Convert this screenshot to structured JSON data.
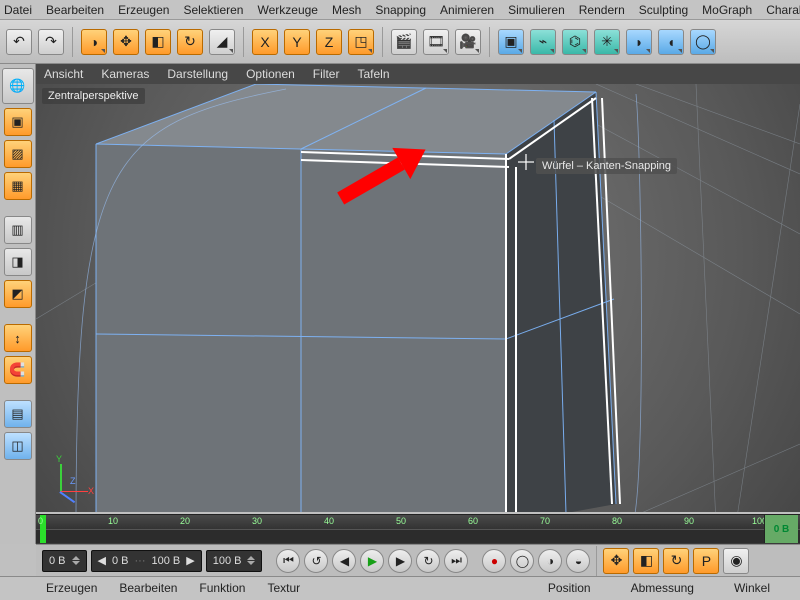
{
  "menu": {
    "items": [
      "Datei",
      "Bearbeiten",
      "Erzeugen",
      "Selektieren",
      "Werkzeuge",
      "Mesh",
      "Snapping",
      "Animieren",
      "Simulieren",
      "Rendern",
      "Sculpting",
      "MoGraph",
      "Charak"
    ]
  },
  "toolbar": {
    "undo": "↶",
    "redo": "↷",
    "live": "◑",
    "move": "✥",
    "scale": "◧",
    "rot": "↻",
    "lasttool": "◢",
    "x": "X",
    "y": "Y",
    "z": "Z",
    "coord": "◳",
    "render": "🎬",
    "renderreg": "🎞",
    "rendset": "🎥",
    "prim": "▣",
    "def": "⌁",
    "gen": "⌬",
    "env": "✳",
    "cam": "◗",
    "light": "◖",
    "spline": "◯"
  },
  "lefttools": {
    "cube": "▣",
    "poly": "▨",
    "mat": "▦",
    "model": "▥",
    "obj": "◨",
    "tex": "◩",
    "axis": "↕",
    "snap": "🧲",
    "grid": "▤",
    "iso": "◫"
  },
  "viewmenu": {
    "items": [
      "Ansicht",
      "Kameras",
      "Darstellung",
      "Optionen",
      "Filter",
      "Tafeln"
    ]
  },
  "viewlabel": "Zentralperspektive",
  "tooltip": "Würfel – Kanten-Snapping",
  "gizmo": {
    "x": "X",
    "y": "Y",
    "z": "Z"
  },
  "timeline": {
    "ticks": [
      0,
      10,
      20,
      30,
      40,
      50,
      60,
      70,
      80,
      90,
      100
    ],
    "badge": "0 B"
  },
  "transport": {
    "cur": "0 B",
    "range_a": "0 B",
    "range_b": "100 B",
    "end": "100 B",
    "first": "⏮",
    "keyprev": "↺",
    "prev": "◀",
    "play": "▶",
    "next": "▶",
    "keynext": "↻",
    "last": "⏭",
    "rec": "●",
    "autokey": "◯",
    "keysel": "◑",
    "keyopt": "◒",
    "moveT": "✥",
    "scaleT": "◧",
    "rotT": "↻",
    "param": "P",
    "anim": "◉"
  },
  "matmenu": {
    "items": [
      "Erzeugen",
      "Bearbeiten",
      "Funktion",
      "Textur"
    ]
  },
  "attrs": {
    "pos": "Position",
    "size": "Abmessung",
    "ang": "Winkel"
  }
}
